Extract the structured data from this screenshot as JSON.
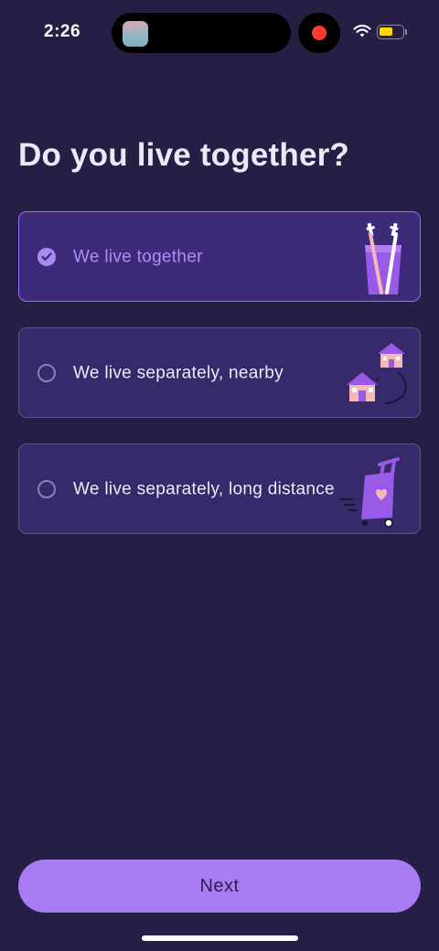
{
  "status_bar": {
    "time": "2:26",
    "record_color": "#ff3b30",
    "battery_color": "#ffd60a",
    "icons": [
      "wifi-icon",
      "battery-icon",
      "record-indicator"
    ]
  },
  "page": {
    "title": "Do you live together?"
  },
  "options": [
    {
      "label": "We live together",
      "selected": true,
      "icon": "toothbrush-cup-illustration"
    },
    {
      "label": "We live separately, nearby",
      "selected": false,
      "icon": "two-houses-illustration"
    },
    {
      "label": "We live separately, long distance",
      "selected": false,
      "icon": "suitcase-illustration"
    }
  ],
  "footer": {
    "next_label": "Next"
  },
  "colors": {
    "background": "#251e45",
    "accent": "#a77cf3",
    "option_background": "#362a6b",
    "selected_text": "#b18cf8"
  }
}
